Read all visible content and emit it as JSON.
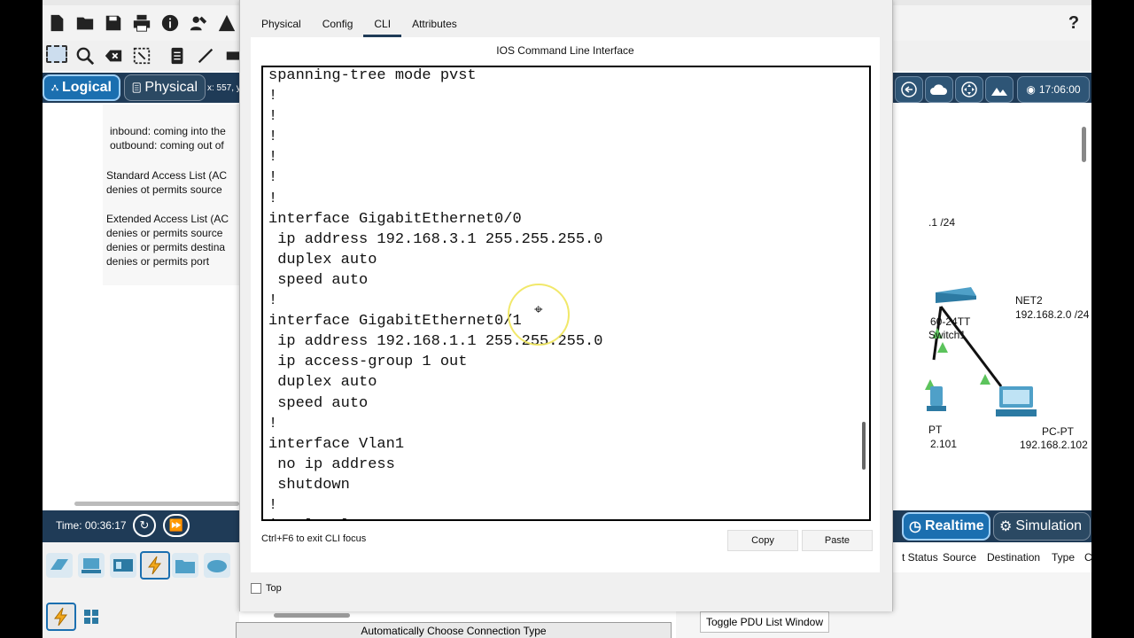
{
  "toolbar": {
    "help_label": "?"
  },
  "viewbar": {
    "logical_label": "Logical",
    "physical_label": "Physical",
    "coords_label": "x: 557, y",
    "clock_label": "17:06:00"
  },
  "notes": {
    "line1": "inbound: coming into the",
    "line2": "outbound: coming out of",
    "line3": "Standard Access List (AC",
    "line4": "denies ot permits source",
    "line5": "Extended Access List (AC",
    "line6": "denies or permits source",
    "line7": "denies or permits destina",
    "line8": "denies or permits port"
  },
  "topology": {
    "net1_label": ".1 /24",
    "net2_name": "NET2",
    "net2_addr": "192.168.2.0 /24",
    "switch_model": "60-24TT",
    "switch_name": "Switch1",
    "pc_left_name": "PT",
    "pc_left_ip": "2.101",
    "pc_right_name": "PC-PT",
    "pc_right_ip": "192.168.2.102"
  },
  "bottom": {
    "time_label": "Time: 00:36:17",
    "realtime_label": "Realtime",
    "simulation_label": "Simulation",
    "toggle_pdu_label": "Toggle PDU List Window",
    "connection_label": "Automatically Choose Connection Type"
  },
  "pdu_table": {
    "columns": [
      "t Status",
      "Source",
      "Destination",
      "Type",
      "C"
    ]
  },
  "modal": {
    "tabs": [
      "Physical",
      "Config",
      "CLI",
      "Attributes"
    ],
    "active_tab": "CLI",
    "title": "IOS Command Line Interface",
    "cli_lines": [
      "spanning-tree mode pvst",
      "!",
      "!",
      "!",
      "!",
      "!",
      "!",
      "interface GigabitEthernet0/0",
      " ip address 192.168.3.1 255.255.255.0",
      " duplex auto",
      " speed auto",
      "!",
      "interface GigabitEthernet0/1",
      " ip address 192.168.1.1 255.255.255.0",
      " ip access-group 1 out",
      " duplex auto",
      " speed auto",
      "!",
      "interface Vlan1",
      " no ip address",
      " shutdown",
      "!",
      "ip classless"
    ],
    "hint": "Ctrl+F6 to exit CLI focus",
    "copy_label": "Copy",
    "paste_label": "Paste",
    "top_label": "Top"
  },
  "colors": {
    "nav_bar": "#1f3b57",
    "active_mode": "#1b6fb0",
    "link_line": "#111111",
    "port_up": "#5cc35c",
    "cursor_highlight": "#f0e65a"
  }
}
